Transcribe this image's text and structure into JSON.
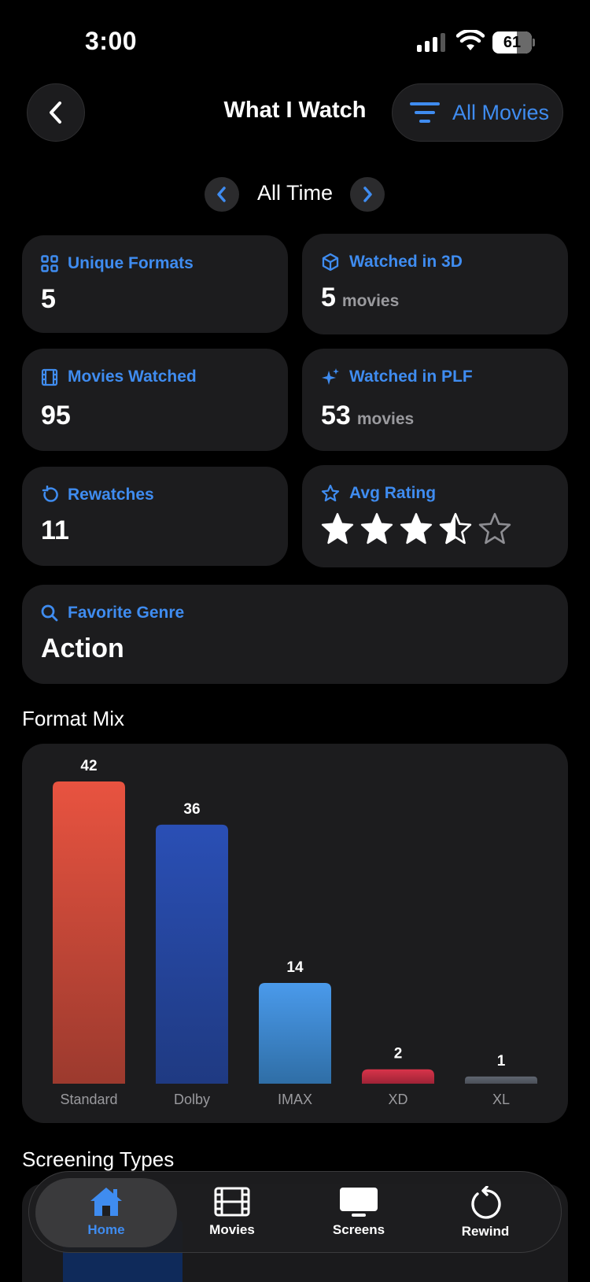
{
  "status_bar": {
    "time": "3:00",
    "battery": "61"
  },
  "header": {
    "title": "What I Watch",
    "filter_label": "All Movies"
  },
  "period": {
    "label": "All Time"
  },
  "stats": {
    "unique_formats": {
      "label": "Unique Formats",
      "value": "5"
    },
    "watched_3d": {
      "label": "Watched in 3D",
      "value": "5",
      "unit": "movies"
    },
    "movies_watched": {
      "label": "Movies Watched",
      "value": "95"
    },
    "watched_plf": {
      "label": "Watched in PLF",
      "value": "53",
      "unit": "movies"
    },
    "rewatches": {
      "label": "Rewatches",
      "value": "11"
    },
    "avg_rating": {
      "label": "Avg Rating",
      "stars": 3.5,
      "max": 5
    },
    "favorite_genre": {
      "label": "Favorite Genre",
      "value": "Action"
    }
  },
  "sections": {
    "format_mix": "Format Mix",
    "screening_types": "Screening Types"
  },
  "chart_data": {
    "type": "bar",
    "categories": [
      "Standard",
      "Dolby",
      "IMAX",
      "XD",
      "XL"
    ],
    "values": [
      42,
      36,
      14,
      2,
      1
    ],
    "colors": [
      [
        "#e85340",
        "#9c3a2e"
      ],
      [
        "#2a4fb5",
        "#1f3a82"
      ],
      [
        "#4a9aeb",
        "#2f6ea6"
      ],
      [
        "#d8344a",
        "#9e2336"
      ],
      [
        "#5f6570",
        "#4a4f58"
      ]
    ],
    "ylim": [
      0,
      42
    ]
  },
  "tab_bar": {
    "tabs": [
      {
        "label": "Home",
        "icon": "home-icon",
        "active": true
      },
      {
        "label": "Movies",
        "icon": "film-icon",
        "active": false
      },
      {
        "label": "Screens",
        "icon": "screen-icon",
        "active": false
      },
      {
        "label": "Rewind",
        "icon": "rewind-icon",
        "active": false
      }
    ]
  },
  "colors": {
    "accent": "#3f8cf0",
    "card": "#1c1c1e",
    "background": "#000000"
  }
}
